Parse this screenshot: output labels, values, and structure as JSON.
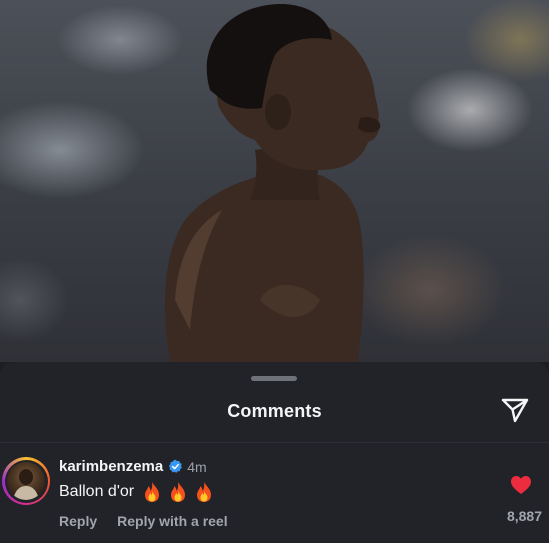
{
  "post": {
    "image_icon": "player-photo"
  },
  "sheet": {
    "title": "Comments",
    "share_icon": "send-icon"
  },
  "comment": {
    "avatar_icon": "avatar",
    "username": "karimbenzema",
    "verified_icon": "verified-badge-icon",
    "time": "4m",
    "text": "Ballon d'or",
    "emojis": [
      "🔥",
      "🔥",
      "🔥"
    ],
    "reply_label": "Reply",
    "reply_reel_label": "Reply with a reel",
    "like_icon": "heart-icon",
    "like_count": "8,887"
  },
  "colors": {
    "sheet_bg": "#212328",
    "like_red": "#ed2d3f",
    "verified_blue": "#3897f0"
  }
}
